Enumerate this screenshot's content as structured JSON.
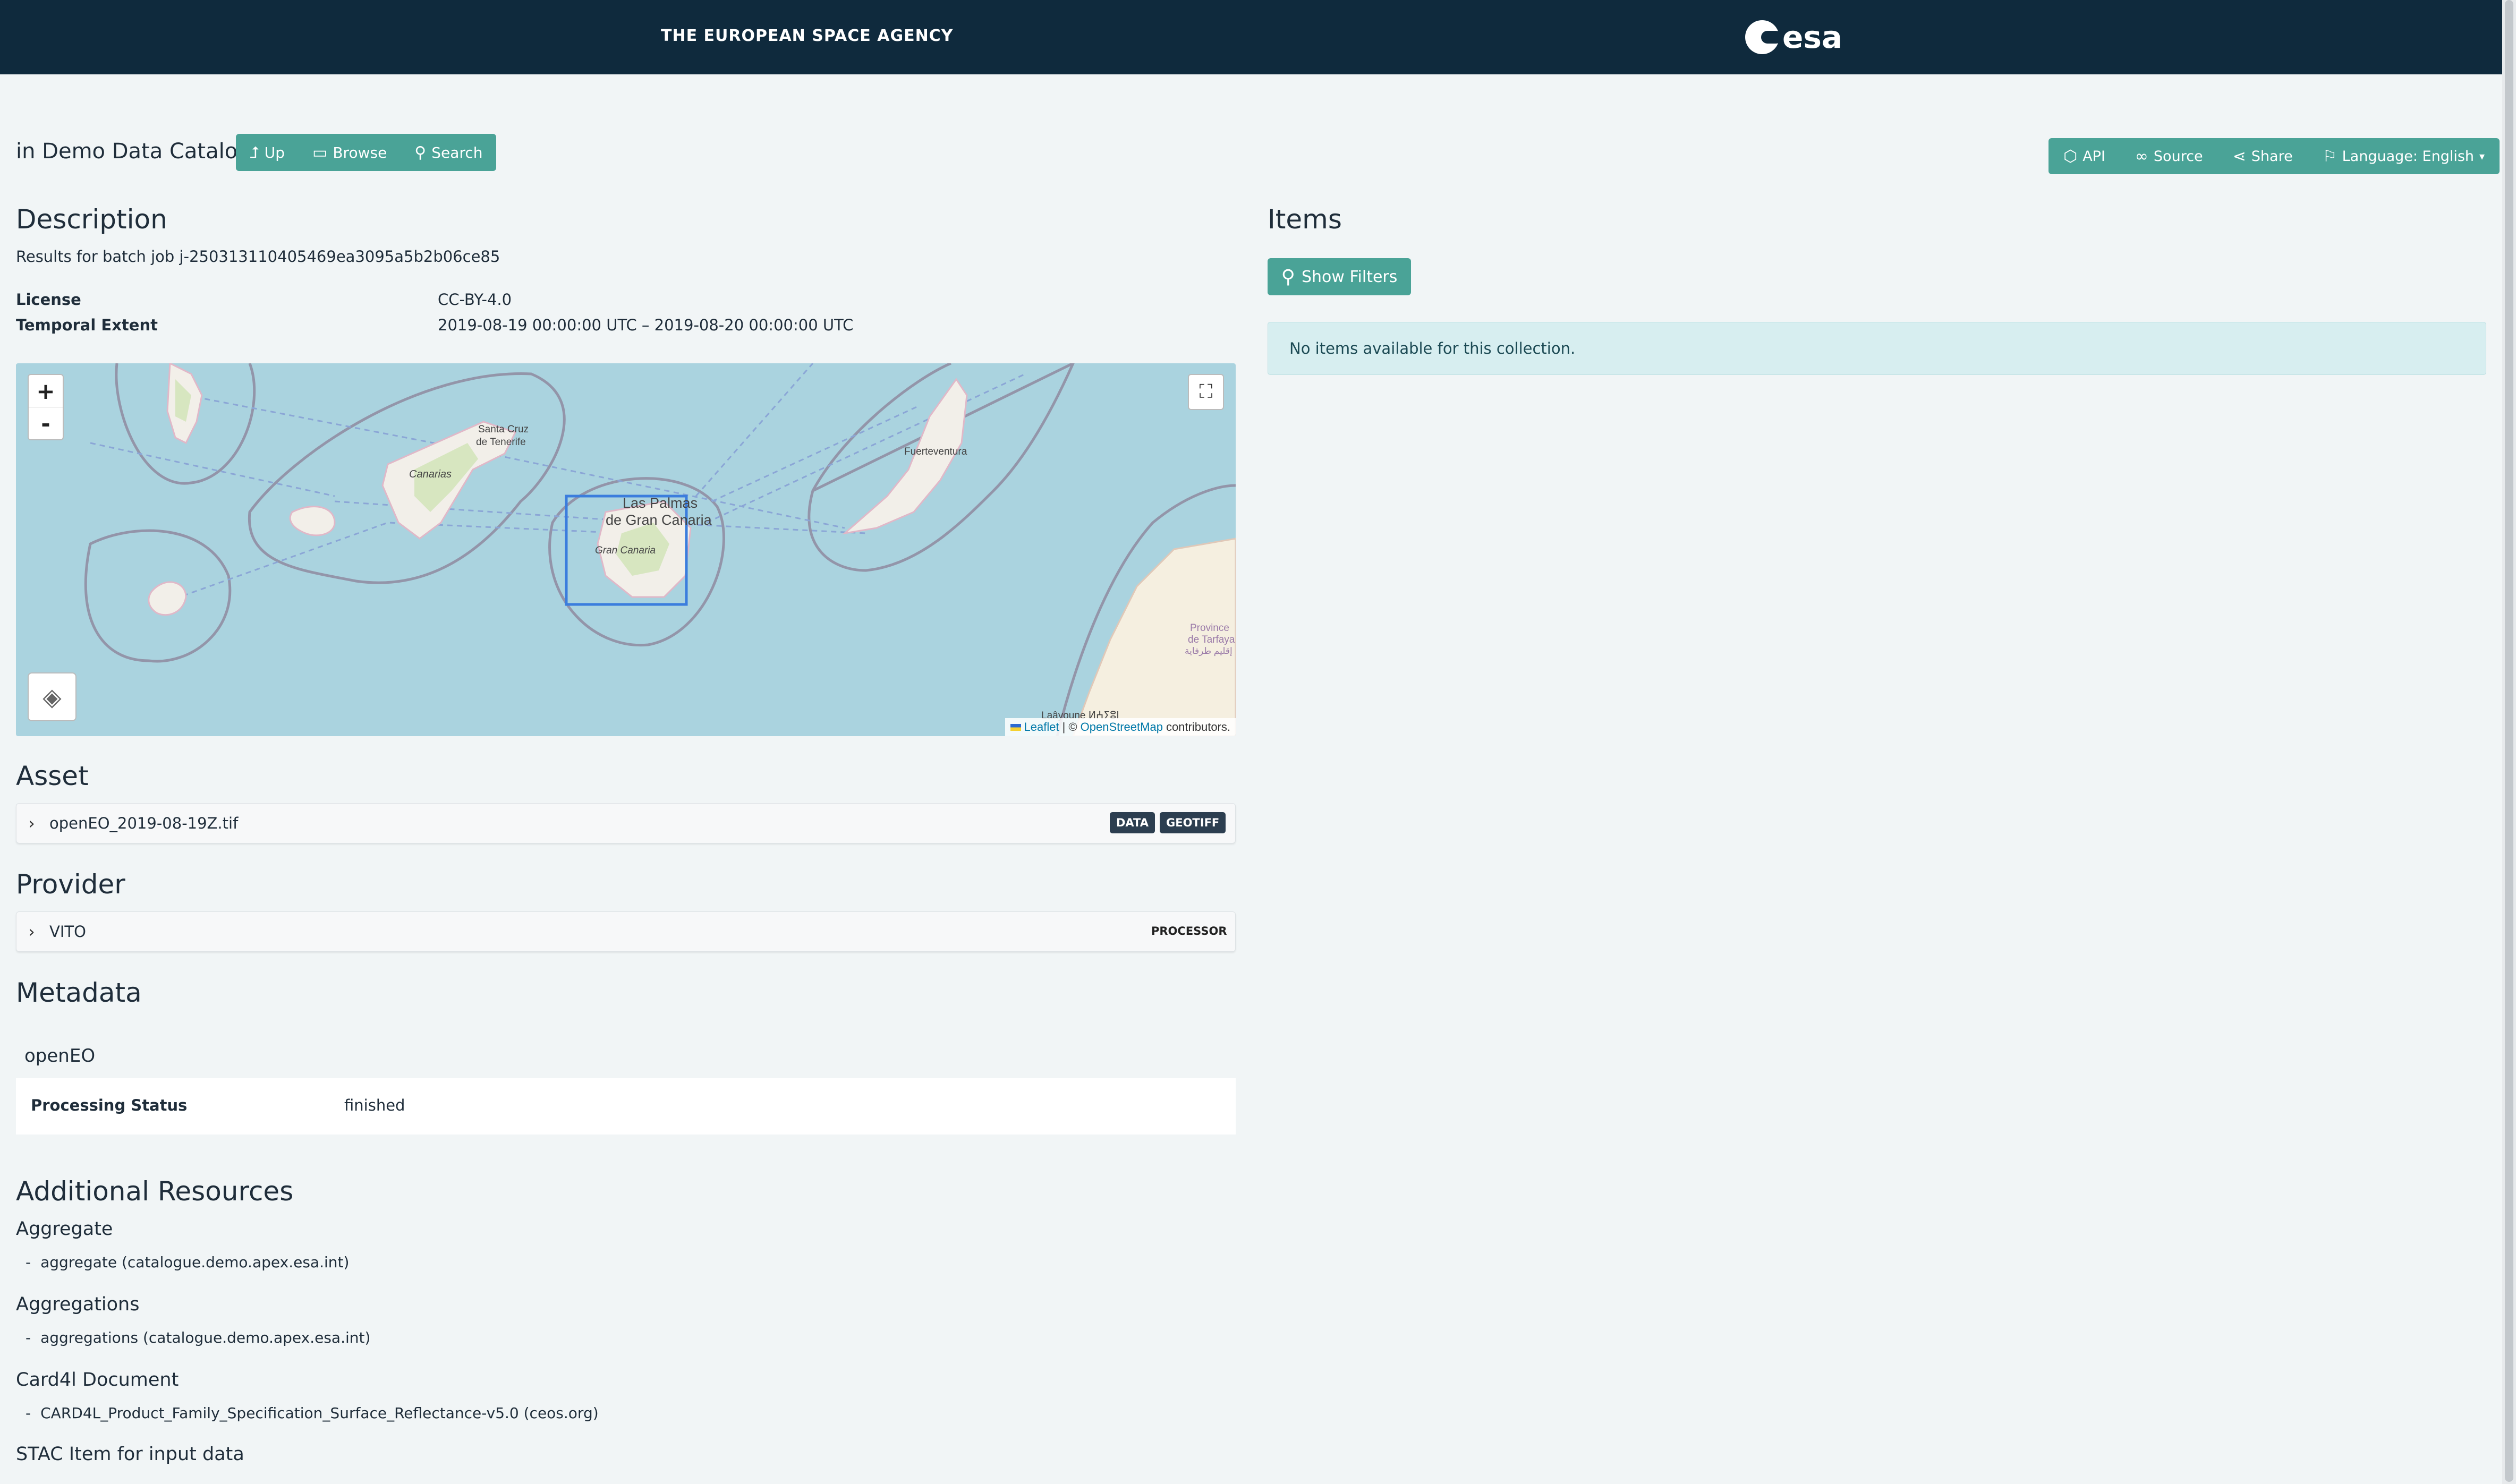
{
  "header": {
    "agency": "THE EUROPEAN SPACE AGENCY",
    "logo_text": "esa",
    "background": "#0f2a3d"
  },
  "breadcrumb": {
    "text": "in Demo Data Catalogue"
  },
  "nav": {
    "up": "Up",
    "browse": "Browse",
    "search": "Search"
  },
  "tools": {
    "api": "API",
    "source": "Source",
    "share": "Share",
    "language": "Language: English"
  },
  "description": {
    "heading": "Description",
    "text": "Results for batch job j-250313110405469ea3095a5b2b06ce85",
    "fields": [
      {
        "label": "License",
        "value": "CC-BY-4.0"
      },
      {
        "label": "Temporal Extent",
        "value": "2019-08-19 00:00:00 UTC – 2019-08-20 00:00:00 UTC"
      }
    ]
  },
  "map": {
    "zoom_in": "+",
    "zoom_out": "-",
    "labels": {
      "santa_cruz_1": "Santa Cruz",
      "santa_cruz_2": "de Tenerife",
      "canarias": "Canarias",
      "las_palmas_1": "Las Palmas",
      "las_palmas_2": "de Gran Canaria",
      "gran_canaria": "Gran Canaria",
      "fuerteventura": "Fuerteventura",
      "province_1": "Province",
      "province_2": "de Tarfaya",
      "province_3": "إقليم طرفاية",
      "bottom_town": "Laâyoune ⵍⵄⵢⵓⵏ"
    },
    "attribution": {
      "leaflet": "Leaflet",
      "sep": "| ©",
      "osm": "OpenStreetMap",
      "rest": "contributors."
    },
    "water_color": "#aad3df",
    "bbox_color": "#3b7ddd"
  },
  "asset": {
    "heading": "Asset",
    "name": "openEO_2019-08-19Z.tif",
    "badges": [
      "DATA",
      "GEOTIFF"
    ]
  },
  "provider": {
    "heading": "Provider",
    "name": "VITO",
    "role": "PROCESSOR"
  },
  "metadata": {
    "heading": "Metadata",
    "group": "openEO",
    "rows": [
      {
        "label": "Processing Status",
        "value": "finished"
      }
    ]
  },
  "resources": {
    "heading": "Additional Resources",
    "groups": [
      {
        "title": "Aggregate",
        "link": "aggregate (catalogue.demo.apex.esa.int)"
      },
      {
        "title": "Aggregations",
        "link": "aggregations (catalogue.demo.apex.esa.int)"
      },
      {
        "title": "Card4l Document",
        "link": "CARD4L_Product_Family_Specification_Surface_Reflectance-v5.0 (ceos.org)"
      },
      {
        "title": "STAC Item for input data",
        "link": ""
      }
    ]
  },
  "items": {
    "heading": "Items",
    "filters_button": "Show Filters",
    "empty_message": "No items available for this collection."
  },
  "accent_color": "#4aa397"
}
